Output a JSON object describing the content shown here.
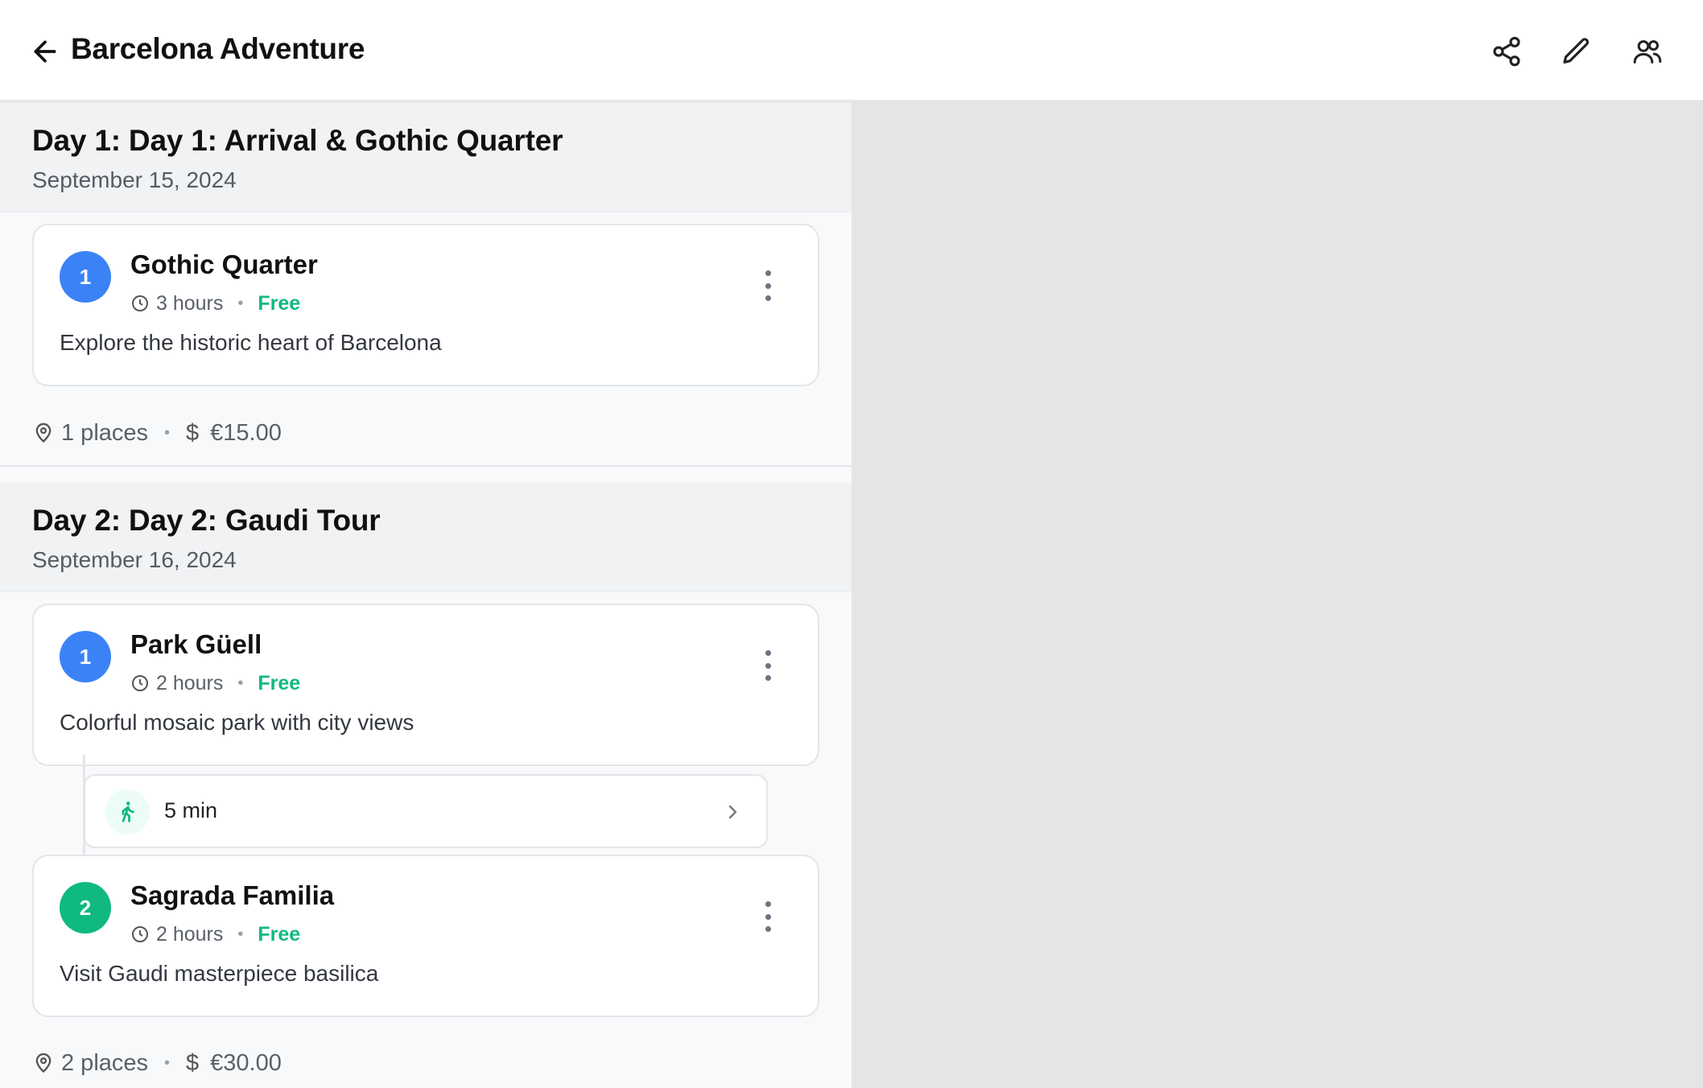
{
  "header": {
    "title": "Barcelona Adventure",
    "icons": [
      "back-arrow-icon",
      "share-icon",
      "edit-pencil-icon",
      "collaborators-icon"
    ]
  },
  "days": [
    {
      "title": "Day 1: Day 1: Arrival & Gothic Quarter",
      "date": "September 15, 2024",
      "places": [
        {
          "number": "1",
          "name": "Gothic Quarter",
          "duration": "3 hours",
          "price": "Free",
          "description": "Explore the historic heart of Barcelona",
          "badge_color": "#3b82f6"
        }
      ],
      "summary": {
        "places": "1 places",
        "currency_symbol": "$",
        "cost": "€15.00"
      }
    },
    {
      "title": "Day 2: Day 2: Gaudi Tour",
      "date": "September 16, 2024",
      "places": [
        {
          "number": "1",
          "name": "Park Güell",
          "duration": "2 hours",
          "price": "Free",
          "description": "Colorful mosaic park with city views",
          "badge_color": "#3b82f6"
        },
        {
          "number": "2",
          "name": "Sagrada Familia",
          "duration": "2 hours",
          "price": "Free",
          "description": "Visit Gaudi masterpiece basilica",
          "badge_color": "#10b981"
        }
      ],
      "travel": {
        "mode": "walk",
        "time": "5 min"
      },
      "summary": {
        "places": "2 places",
        "currency_symbol": "$",
        "cost": "€30.00"
      }
    }
  ],
  "colors": {
    "accent_blue": "#3b82f6",
    "accent_green": "#10b981",
    "map_bg": "#e5e5e5"
  }
}
